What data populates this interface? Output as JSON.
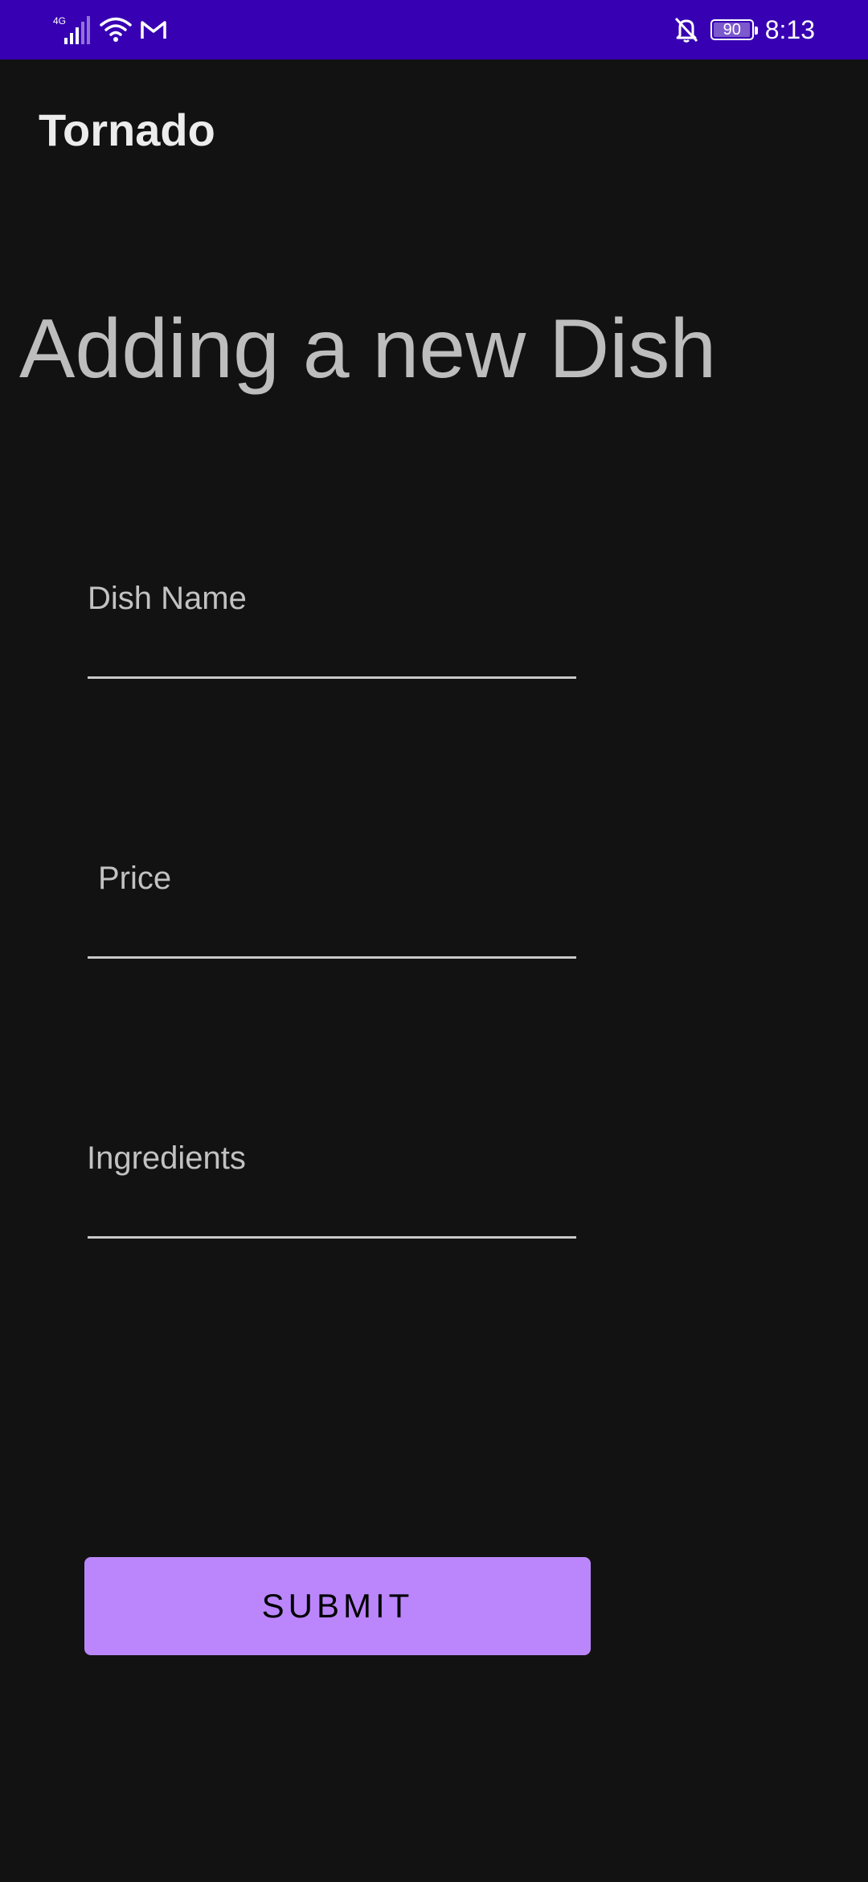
{
  "status_bar": {
    "network_type": "4G",
    "icons": [
      "signal-icon",
      "wifi-icon",
      "gmail-icon",
      "bell-off-icon",
      "battery-icon"
    ],
    "battery_level": "90",
    "time": "8:13",
    "background_color": "#3700b3"
  },
  "app_bar": {
    "title": "Tornado"
  },
  "page": {
    "heading": "Adding a new Dish"
  },
  "form": {
    "fields": [
      {
        "label": "Dish Name",
        "value": ""
      },
      {
        "label": "Price",
        "value": ""
      },
      {
        "label": "Ingredients",
        "value": ""
      }
    ],
    "submit_label": "SUBMIT"
  },
  "colors": {
    "background": "#121212",
    "accent": "#bb86fc",
    "primary_dark": "#3700b3"
  }
}
